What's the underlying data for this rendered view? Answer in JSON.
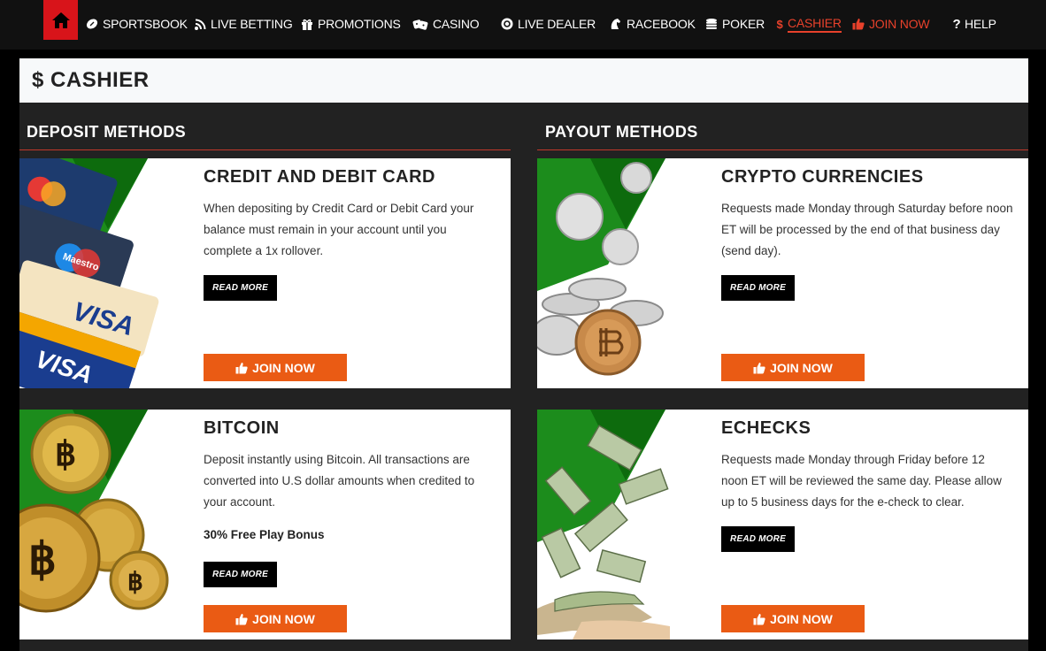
{
  "nav": {
    "items": [
      {
        "label": "SPORTSBOOK",
        "icon": "football-icon"
      },
      {
        "label": "LIVE BETTING",
        "icon": "rss-icon"
      },
      {
        "label": "PROMOTIONS",
        "icon": "gift-icon"
      },
      {
        "label": "CASINO",
        "icon": "dice-icon"
      },
      {
        "label": "LIVE DEALER",
        "icon": "chip-icon"
      },
      {
        "label": "RACEBOOK",
        "icon": "horse-icon"
      },
      {
        "label": "POKER",
        "icon": "coins-icon"
      },
      {
        "label": "CASHIER",
        "icon": "dollar-icon",
        "glyph": "$"
      },
      {
        "label": "JOIN NOW",
        "icon": "thumbs-up-icon"
      },
      {
        "label": "HELP",
        "icon": "question-icon",
        "glyph": "?"
      }
    ],
    "active": "CASHIER",
    "accent": "#e8412b",
    "home_color": "#d8141a"
  },
  "page": {
    "title": "CASHIER",
    "title_glyph": "$"
  },
  "deposit": {
    "heading": "DEPOSIT METHODS",
    "cards": [
      {
        "title": "CREDIT AND DEBIT CARD",
        "desc": "When depositing by Credit Card or Debit Card your balance must remain in your account until you complete a 1x rollover.",
        "read_more": "READ MORE",
        "join": "JOIN NOW"
      },
      {
        "title": "BITCOIN",
        "desc": "Deposit instantly using Bitcoin. All transactions are converted into U.S dollar amounts when credited to your account.",
        "bonus": "30% Free Play Bonus",
        "read_more": "READ MORE",
        "join": "JOIN NOW"
      }
    ]
  },
  "payout": {
    "heading": "PAYOUT METHODS",
    "cards": [
      {
        "title": "CRYPTO CURRENCIES",
        "desc": "Requests made Monday through Saturday before noon ET will be processed by the end of that business day (send day).",
        "read_more": "READ MORE",
        "join": "JOIN NOW"
      },
      {
        "title": "ECHECKS",
        "desc": "Requests made Monday through Friday before 12 noon ET will be reviewed the same day. Please allow up to 5 business days for the e-check to clear.",
        "read_more": "READ MORE",
        "join": "JOIN NOW"
      }
    ]
  },
  "colors": {
    "join_button": "#ea5b14",
    "green_banner": "#1c8c1c",
    "rule": "#c0392b"
  },
  "card_labels": {
    "visa": "VISA",
    "maestro": "Maestro"
  }
}
